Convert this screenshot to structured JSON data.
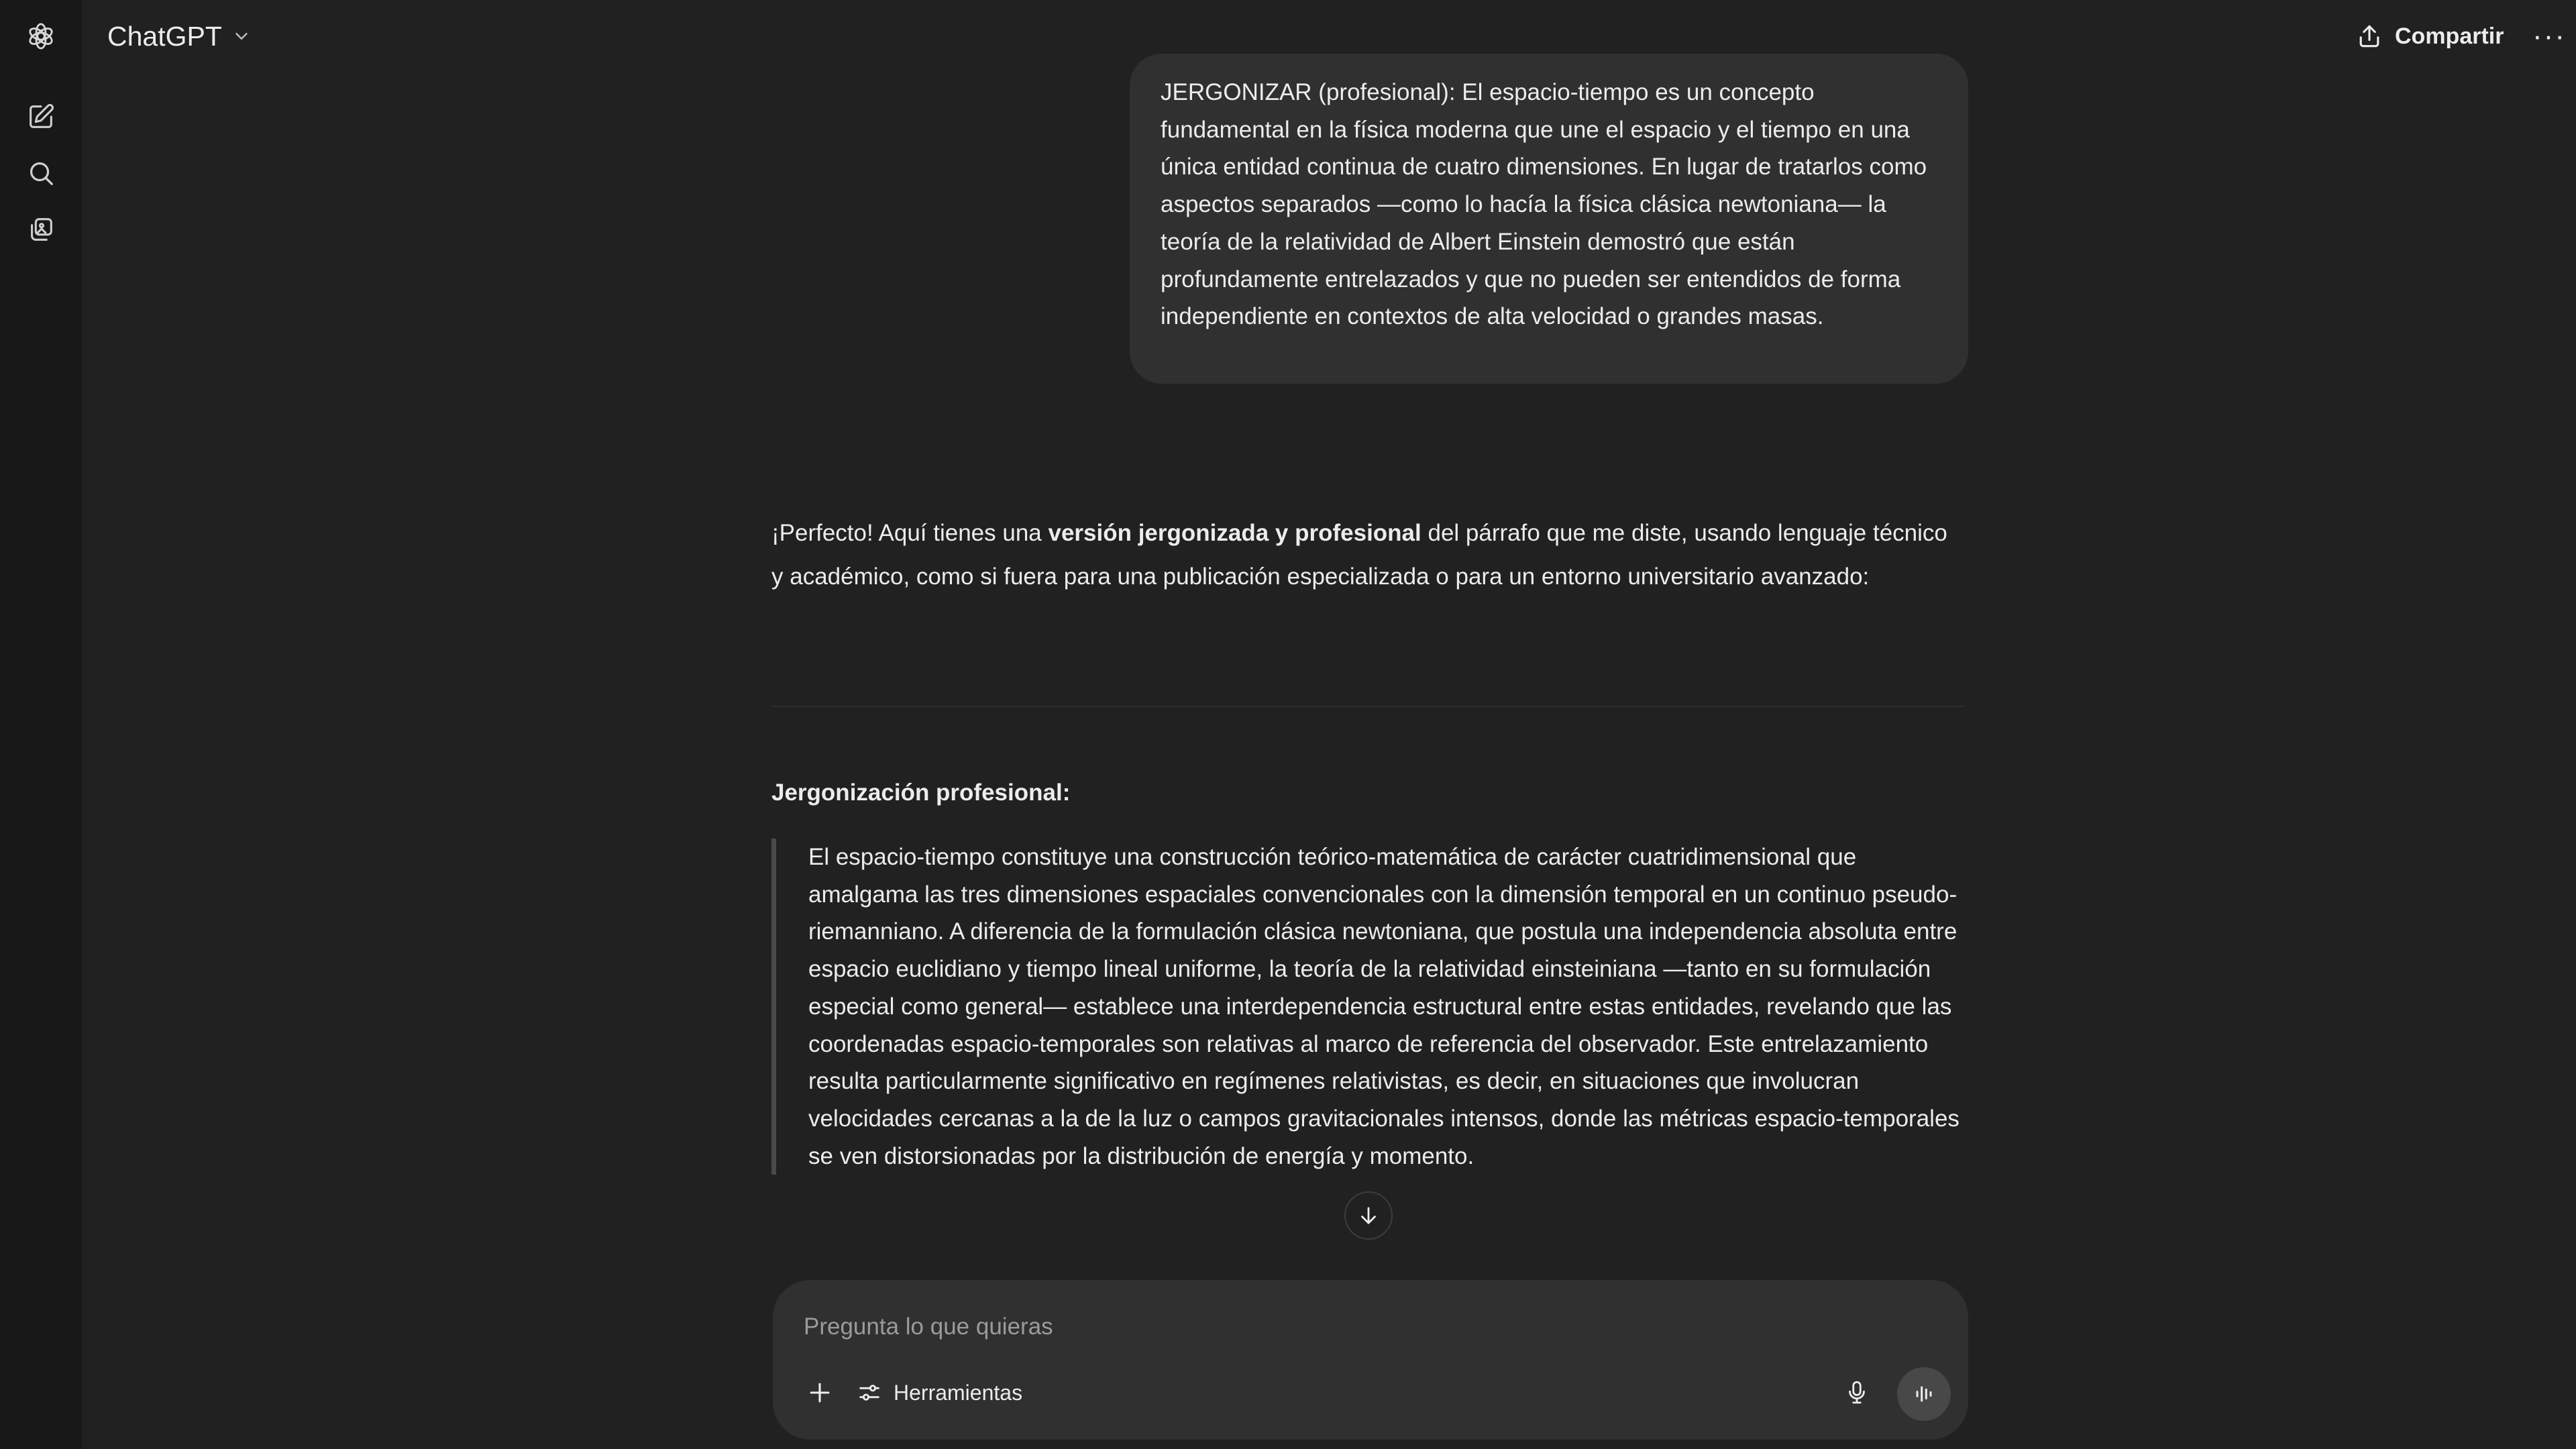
{
  "header": {
    "title": "ChatGPT",
    "share_label": "Compartir",
    "more_label": "···"
  },
  "user_message": "JERGONIZAR (profesional): El espacio-tiempo es un concepto fundamental en la física moderna que une el espacio y el tiempo en una única entidad continua de cuatro dimensiones. En lugar de tratarlos como aspectos separados —como lo hacía la física clásica newtoniana— la teoría de la relatividad de Albert Einstein demostró que están profundamente entrelazados y que no pueden ser entendidos de forma independiente en contextos de alta velocidad o grandes masas.",
  "assistant": {
    "intro_before": "¡Perfecto! Aquí tienes una ",
    "intro_bold": "versión jergonizada y profesional",
    "intro_after": " del párrafo que me diste, usando lenguaje técnico y académico, como si fuera para una publicación especializada o para un entorno universitario avanzado:",
    "section_heading": "Jergonización profesional:",
    "quote": "El espacio-tiempo constituye una construcción teórico-matemática de carácter cuatridimensional que amalgama las tres dimensiones espaciales convencionales con la dimensión temporal en un continuo pseudo-riemanniano. A diferencia de la formulación clásica newtoniana, que postula una independencia absoluta entre espacio euclidiano y tiempo lineal uniforme, la teoría de la relatividad einsteiniana —tanto en su formulación especial como general— establece una interdependencia estructural entre estas entidades, revelando que las coordenadas espacio-temporales son relativas al marco de referencia del observador. Este entrelazamiento resulta particularmente significativo en regímenes relativistas, es decir, en situaciones que involucran velocidades cercanas a la de la luz o campos gravitacionales intensos, donde las métricas espacio-temporales se ven distorsionadas por la distribución de energía y momento."
  },
  "composer": {
    "placeholder": "Pregunta lo que quieras",
    "tools_label": "Herramientas"
  },
  "icons": {
    "logo": "openai-logo-icon",
    "new_chat": "new-chat-icon",
    "search": "search-icon",
    "library": "library-icon",
    "share": "share-icon",
    "scroll_down": "arrow-down-icon",
    "plus": "plus-icon",
    "tools": "sliders-icon",
    "mic": "microphone-icon",
    "voice": "voice-waveform-icon"
  },
  "colors": {
    "background": "#212121",
    "sidebar": "#181818",
    "bubble": "#303030",
    "text": "#ececec",
    "placeholder": "#9b9b9b"
  }
}
